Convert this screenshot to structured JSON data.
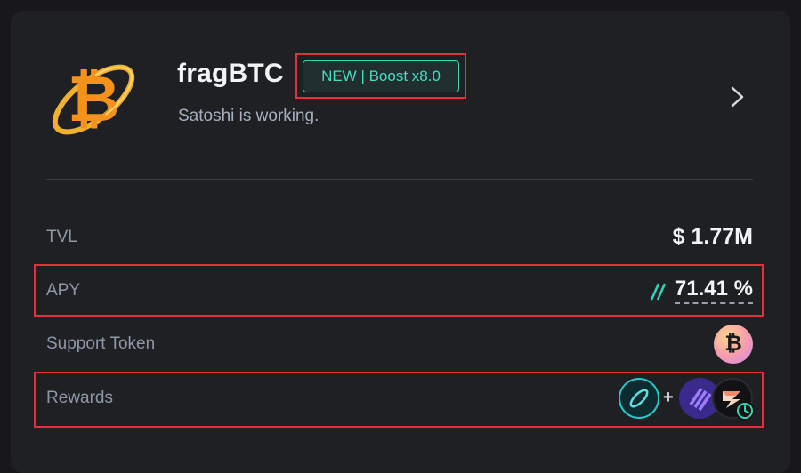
{
  "vault": {
    "name": "fragBTC",
    "badge": "NEW | Boost x8.0",
    "subtitle": "Satoshi is working."
  },
  "stats": {
    "tvl_label": "TVL",
    "tvl_value": "$ 1.77M",
    "apy_label": "APY",
    "apy_value": "71.41 %",
    "support_label": "Support Token",
    "rewards_label": "Rewards",
    "rewards_plus": "+"
  },
  "icons": {
    "logo": "bitcoin-ring-icon",
    "next": "chevron-right-icon",
    "apy": "double-slash-icon",
    "support_token": "bitcoin-icon",
    "rewards": [
      "link-icon",
      "stripes-icon",
      "lightning-icon",
      "clock-icon"
    ]
  },
  "colors": {
    "accent": "#2fd6b4",
    "highlight": "#e0323a",
    "bitcoin": "#f7931a"
  }
}
